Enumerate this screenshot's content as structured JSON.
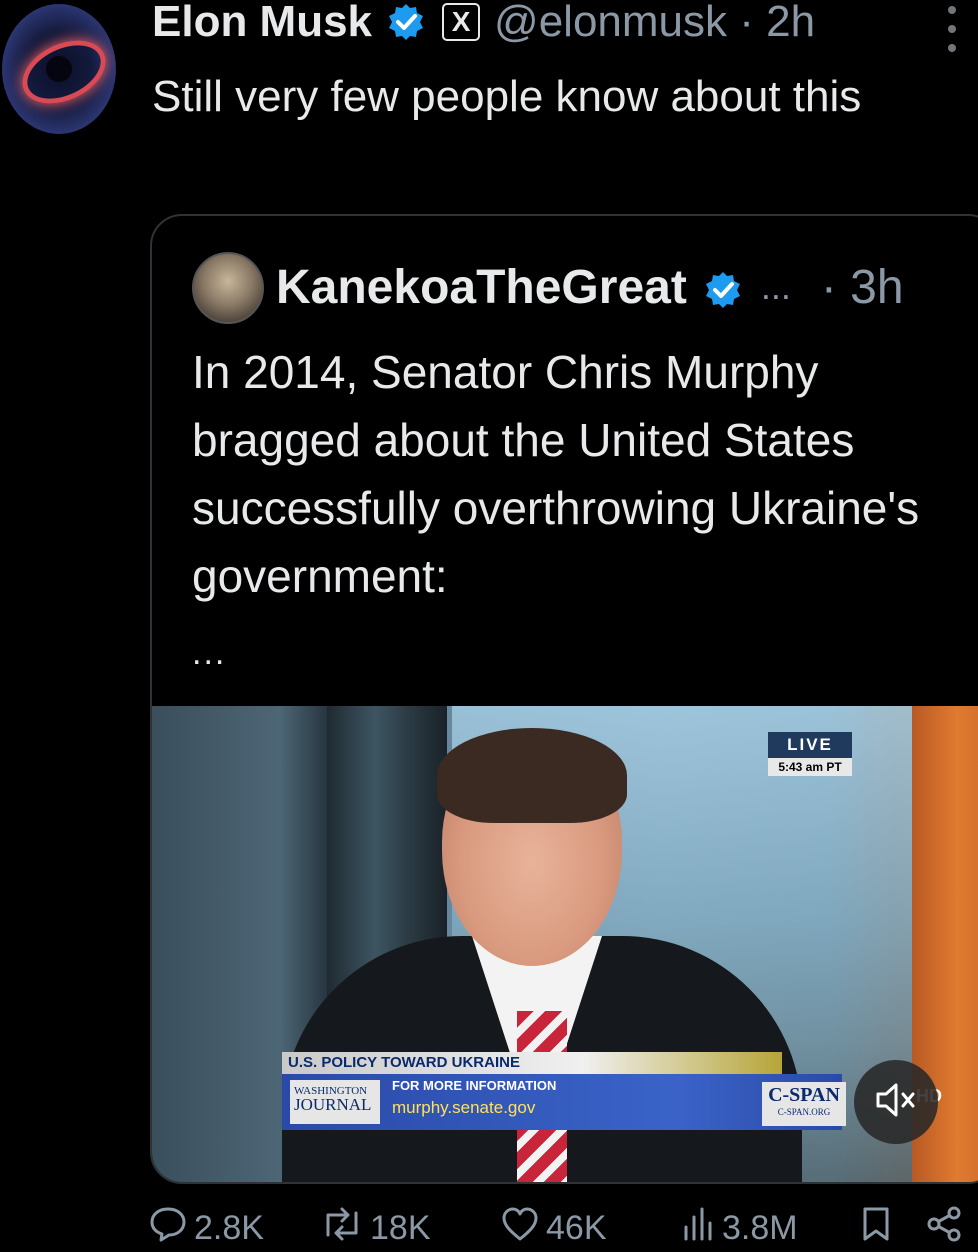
{
  "tweet": {
    "author_name": "Elon Musk",
    "x_badge": "X",
    "handle_time": "@elonmusk · 2h",
    "text": "Still very few people know about this"
  },
  "quote": {
    "author_name": "KanekoaTheGreat",
    "dots": "...",
    "time": "· 3h",
    "text": "In 2014, Senator Chris Murphy bragged about the United States successfully overthrowing Ukraine's government:",
    "ellipsis": "..."
  },
  "video": {
    "live_label": "LIVE",
    "live_time": "5:43 am PT",
    "chyron_title": "U.S. POLICY TOWARD UKRAINE",
    "logo_line1": "WASHINGTON",
    "logo_line2": "JOURNAL",
    "more_info": "FOR MORE INFORMATION",
    "url": "murphy.senate.gov",
    "cspan": "C-SPAN",
    "cspan_org": "C-SPAN.ORG",
    "hd": "HD"
  },
  "actions": {
    "replies": "2.8K",
    "reposts": "18K",
    "likes": "46K",
    "views": "3.8M"
  },
  "colors": {
    "verified": "#1d9bf0",
    "muted_text": "#8b98a5",
    "background": "#000000"
  }
}
